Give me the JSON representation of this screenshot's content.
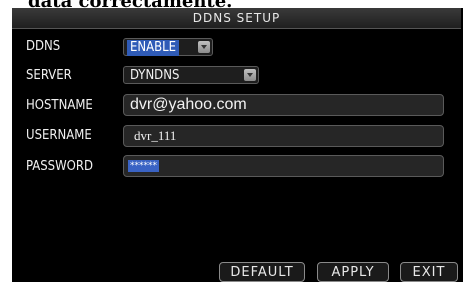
{
  "page_caption": "data correctamente.",
  "window": {
    "title": "DDNS SETUP"
  },
  "form": {
    "ddns": {
      "label": "DDNS",
      "value": "ENABLE"
    },
    "server": {
      "label": "SERVER",
      "value": "DYNDNS"
    },
    "hostname": {
      "label": "HOSTNAME",
      "value": "dvr@yahoo.com"
    },
    "username": {
      "label": "USERNAME",
      "value": "dvr_111"
    },
    "password": {
      "label": "PASSWORD",
      "value": "******"
    }
  },
  "buttons": {
    "default": "DEFAULT",
    "apply": "APPLY",
    "exit": "EXIT"
  },
  "colors": {
    "screen_bg": "#000000",
    "selection_blue": "#2f5bb7",
    "text": "#f0f0f0"
  },
  "icons": {
    "dropdown": "chevron-down-icon"
  }
}
